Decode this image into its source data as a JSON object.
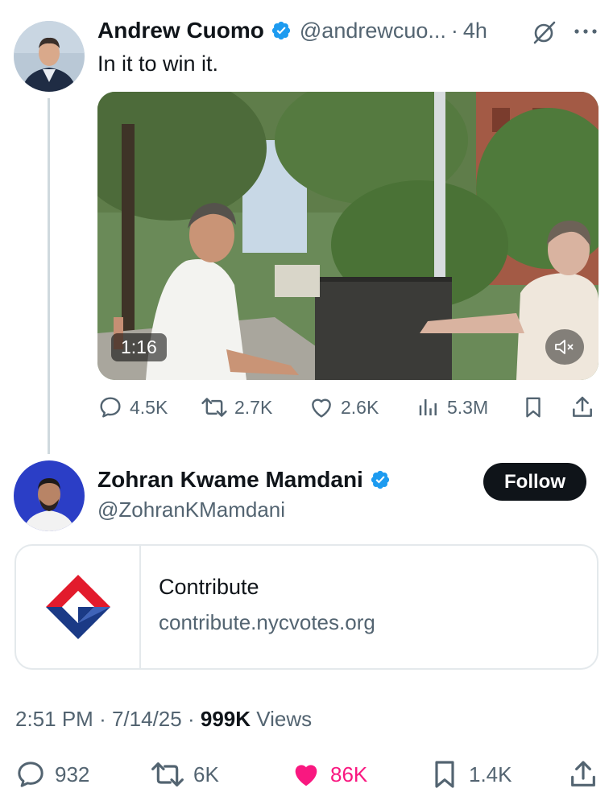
{
  "colors": {
    "text": "#0f1419",
    "secondary": "#536471",
    "verified": "#1d9bf0",
    "like": "#f91880"
  },
  "quoted_tweet": {
    "author_name": "Andrew Cuomo",
    "handle": "@andrewcuo...",
    "separator": "·",
    "time": "4h",
    "text": "In it to win it.",
    "video_duration": "1:16",
    "actions": {
      "replies": "4.5K",
      "reposts": "2.7K",
      "likes": "2.6K",
      "views": "5.3M"
    }
  },
  "main_tweet": {
    "author_name": "Zohran Kwame Mamdani",
    "handle": "@ZohranKMamdani",
    "follow_label": "Follow",
    "link_card": {
      "title": "Contribute",
      "domain": "contribute.nycvotes.org"
    },
    "time": "2:51 PM",
    "date": "7/14/25",
    "meta_sep": "·",
    "views_count": "999K",
    "views_label": "Views",
    "actions": {
      "replies": "932",
      "reposts": "6K",
      "likes": "86K",
      "bookmarks": "1.4K"
    }
  }
}
